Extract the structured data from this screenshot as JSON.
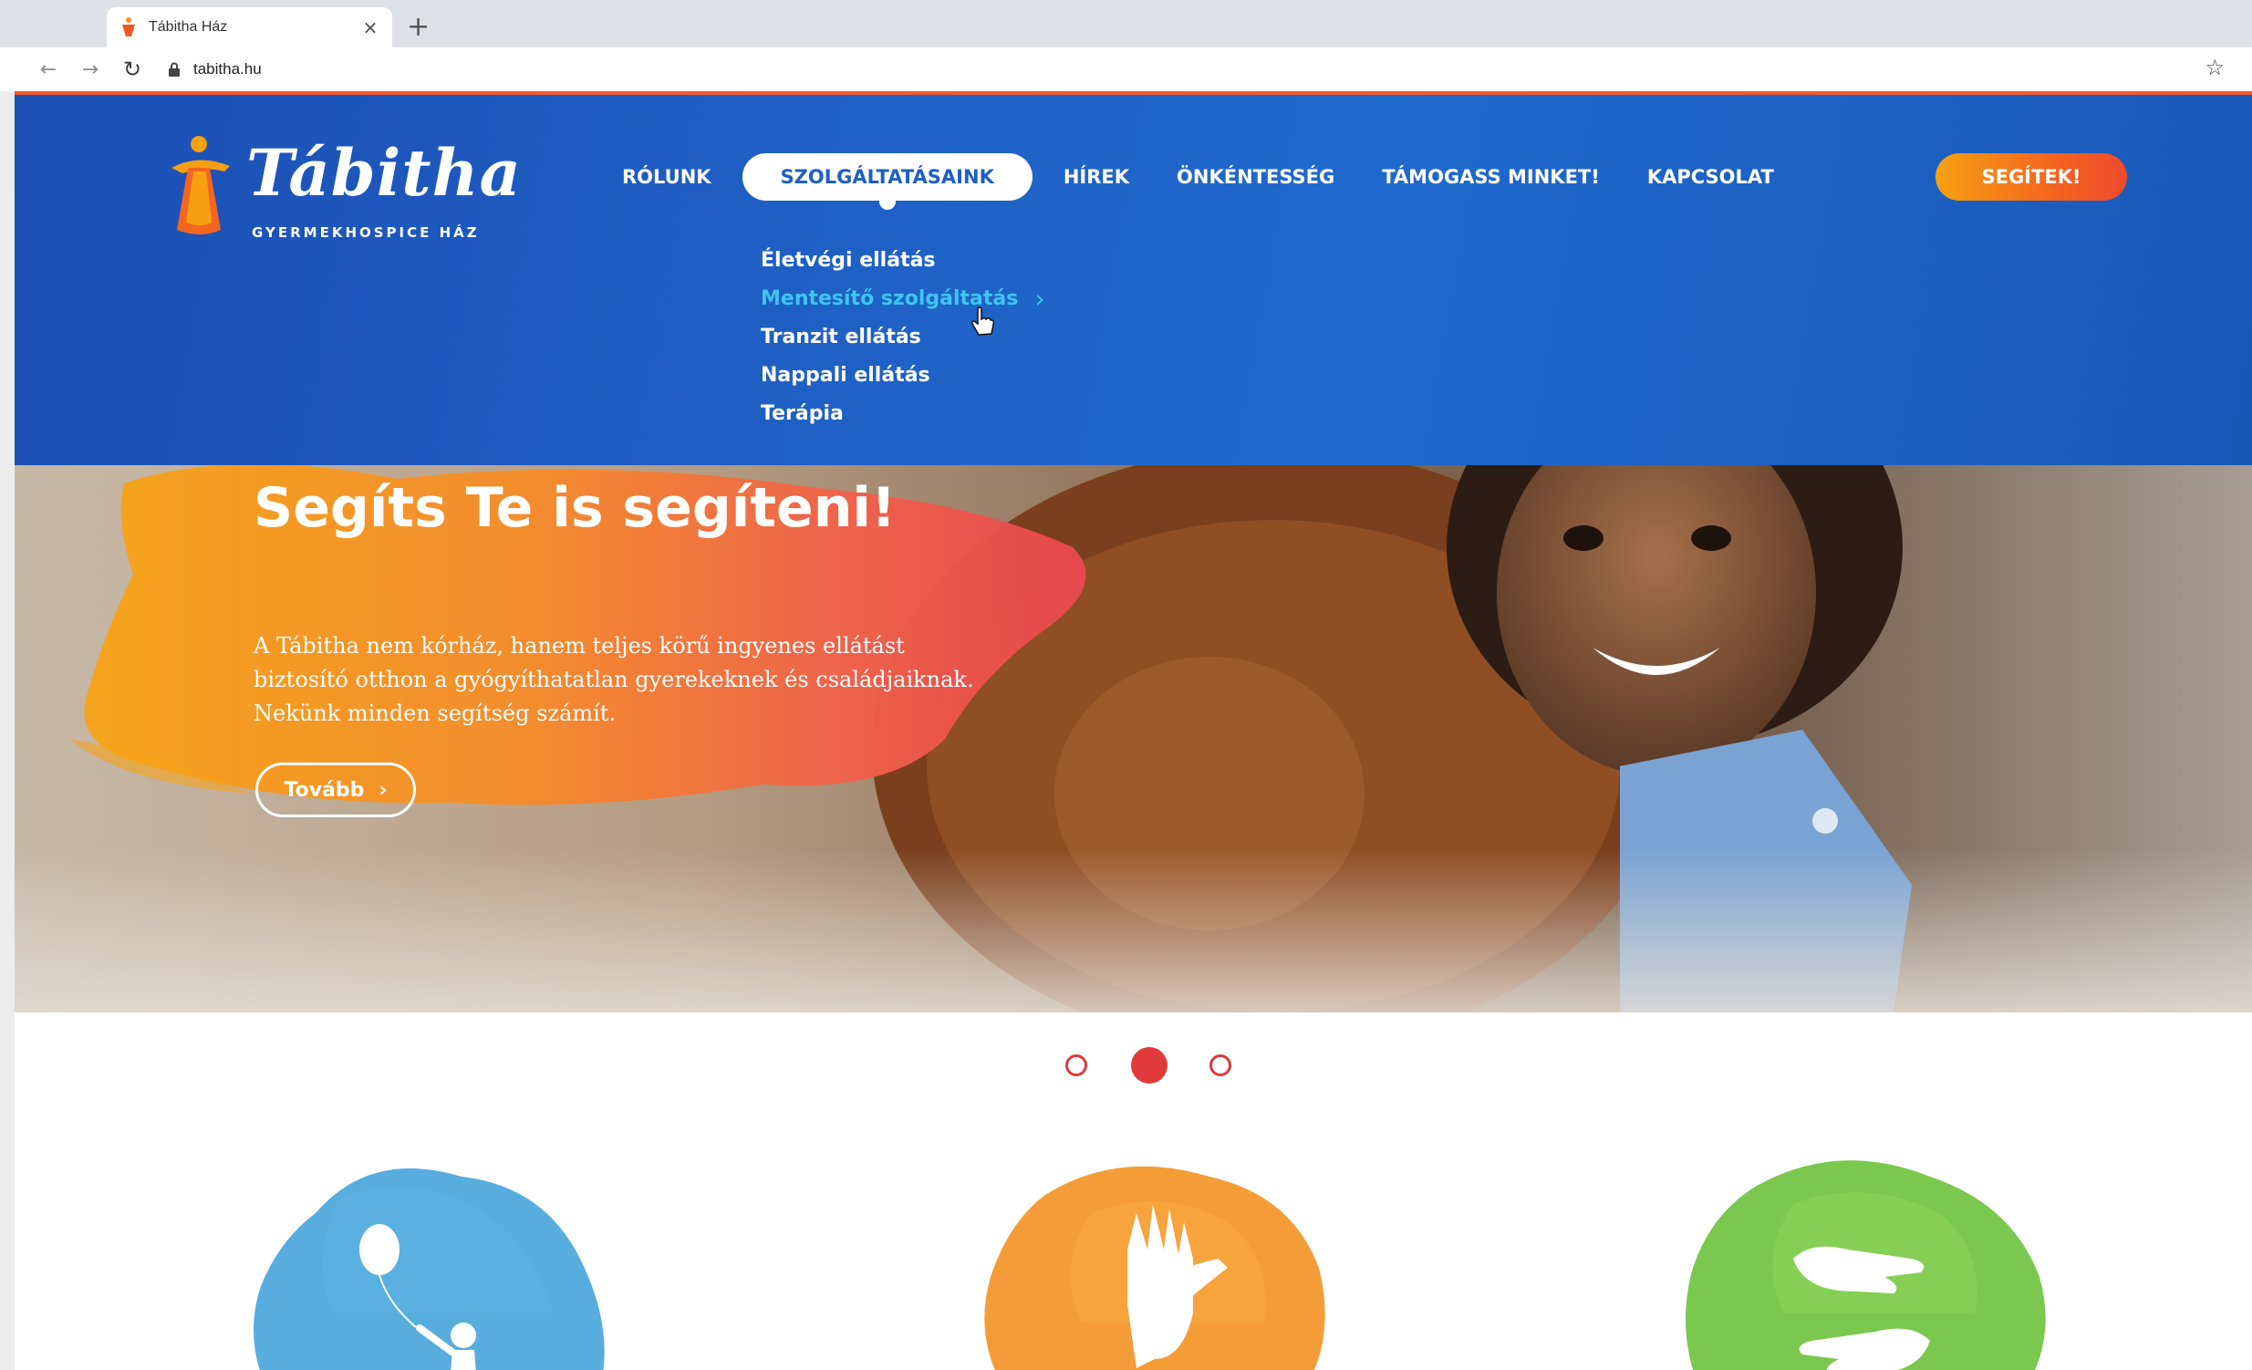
{
  "browser": {
    "tab_title": "Tábitha Ház",
    "tab_close": "×",
    "new_tab": "+",
    "url": "tabitha.hu",
    "back": "←",
    "forward": "→",
    "reload": "↻",
    "star": "☆"
  },
  "logo": {
    "name": "Tábitha",
    "subtitle": "GYERMEKHOSPICE HÁZ"
  },
  "nav": {
    "items": [
      {
        "label": "RÓLUNK"
      },
      {
        "label": "SZOLGÁLTATÁSAINK",
        "active": true
      },
      {
        "label": "HÍREK"
      },
      {
        "label": "ÖNKÉNTESSÉG"
      },
      {
        "label": "TÁMOGASS MINKET!"
      },
      {
        "label": "KAPCSOLAT"
      }
    ],
    "cta": "SEGÍTEK!"
  },
  "submenu": {
    "items": [
      {
        "label": "Életvégi ellátás"
      },
      {
        "label": "Mentesítő szolgáltatás",
        "hover": true,
        "chevron": "›"
      },
      {
        "label": "Tranzit ellátás"
      },
      {
        "label": "Nappali ellátás"
      },
      {
        "label": "Terápia"
      }
    ]
  },
  "hero": {
    "title": "Segíts Te is segíteni!",
    "text_lines": [
      "A Tábitha nem kórház, hanem teljes körű ingyenes ellátást",
      "biztosító otthon a gyógyíthatatlan gyerekeknek és családjaiknak.",
      "Nekünk minden segítség számít."
    ],
    "button_label": "Tovább",
    "button_chevron": "›"
  },
  "carousel": {
    "slide_count": 3,
    "active_slide": 2
  },
  "features": [
    {
      "icon": "child-with-balloon-icon",
      "color": "#3a9fd8"
    },
    {
      "icon": "helping-hands-icon",
      "color": "#f39222"
    },
    {
      "icon": "giving-hands-icon",
      "color": "#6cc23a"
    }
  ],
  "colors": {
    "header_blue": "#1f5fc4",
    "submenu_hover": "#3ec5f2",
    "cta_orange": "#f4661f",
    "dot_red": "#e03a3a"
  }
}
